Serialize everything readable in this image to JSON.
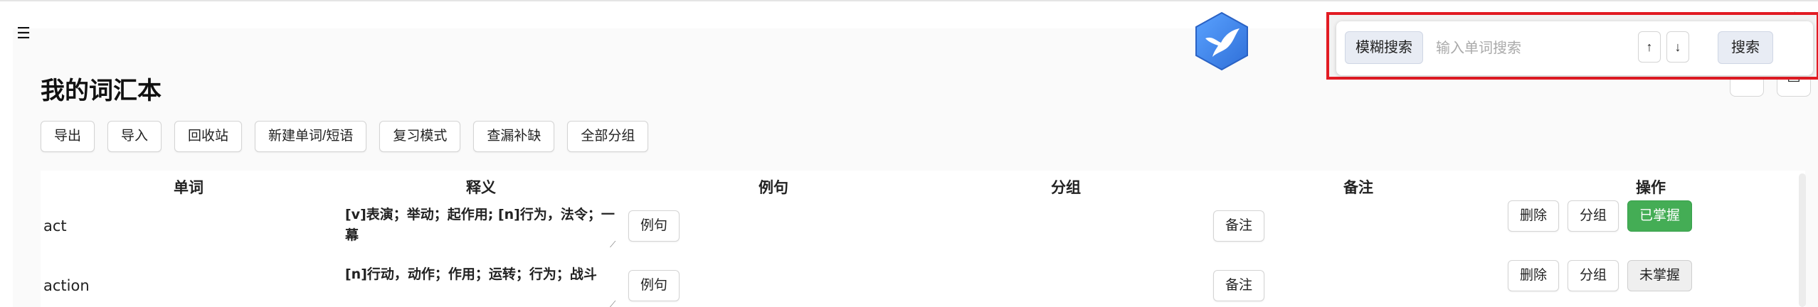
{
  "window": {
    "close_glyph": "✕",
    "minimize_glyph": "–",
    "maximize_glyph": "☐"
  },
  "menu": {
    "glyph": "☰"
  },
  "logo": {
    "icon": "bird-hexagon-logo",
    "color": "#3f86f2"
  },
  "page": {
    "title": "我的词汇本"
  },
  "toolbar": {
    "export": "导出",
    "import": "导入",
    "recycle_bin": "回收站",
    "new_word": "新建单词/短语",
    "review_mode": "复习模式",
    "fill_gaps": "查漏补缺",
    "all_groups": "全部分组"
  },
  "table": {
    "headers": {
      "word": "单词",
      "meaning": "释义",
      "example": "例句",
      "group": "分组",
      "note": "备注",
      "actions": "操作"
    },
    "rows": [
      {
        "word": "act",
        "meaning": "[v]表演；举动；起作用; [n]行为，法令；一幕",
        "example_btn": "例句",
        "note_btn": "备注",
        "delete_btn": "删除",
        "group_btn": "分组",
        "status_btn": "已掌握"
      },
      {
        "word": "action",
        "meaning": "[n]行动，动作；作用；运转；行为；战斗",
        "example_btn": "例句",
        "note_btn": "备注",
        "delete_btn": "删除",
        "group_btn": "分组",
        "status_btn": "未掌握"
      }
    ]
  },
  "search": {
    "fuzzy_label": "模糊搜索",
    "placeholder": "输入单词搜索",
    "up_arrow": "↑",
    "down_arrow": "↓",
    "submit_label": "搜索",
    "highlight_color": "#e21b23"
  },
  "colors": {
    "mastered": "#44ad55",
    "accent": "#3f86f2"
  }
}
